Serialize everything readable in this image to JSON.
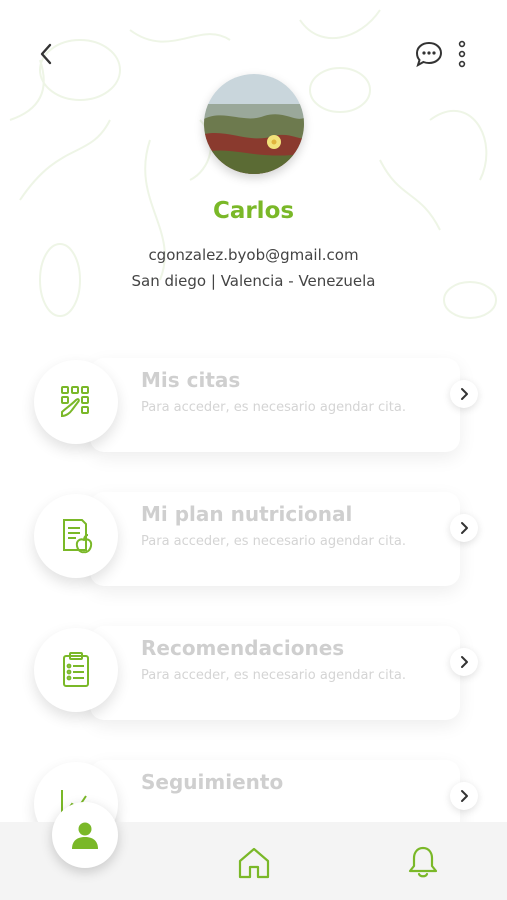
{
  "colors": {
    "accent": "#7ab828",
    "muted_text": "#cfcfcf",
    "body_text": "#444444"
  },
  "profile": {
    "name": "Carlos",
    "email": "cgonzalez.byob@gmail.com",
    "location": "San diego | Valencia - Venezuela"
  },
  "header": {
    "back_icon": "chevron-left-icon",
    "chat_icon": "chat-bubble-icon",
    "more_icon": "more-vertical-icon"
  },
  "menu": [
    {
      "title": "Mis citas",
      "subtitle": "Para acceder, es necesario agendar cita.",
      "icon": "calendar-grid-icon"
    },
    {
      "title": "Mi plan nutricional",
      "subtitle": "Para acceder, es necesario agendar cita.",
      "icon": "nutrition-plan-icon"
    },
    {
      "title": "Recomendaciones",
      "subtitle": "Para acceder, es necesario agendar cita.",
      "icon": "clipboard-list-icon"
    },
    {
      "title": "Seguimiento",
      "subtitle": "",
      "icon": "chart-progress-icon"
    }
  ],
  "bottom_nav": [
    {
      "icon": "user-icon",
      "active": true
    },
    {
      "icon": "home-icon",
      "active": false
    },
    {
      "icon": "bell-icon",
      "active": false
    }
  ]
}
